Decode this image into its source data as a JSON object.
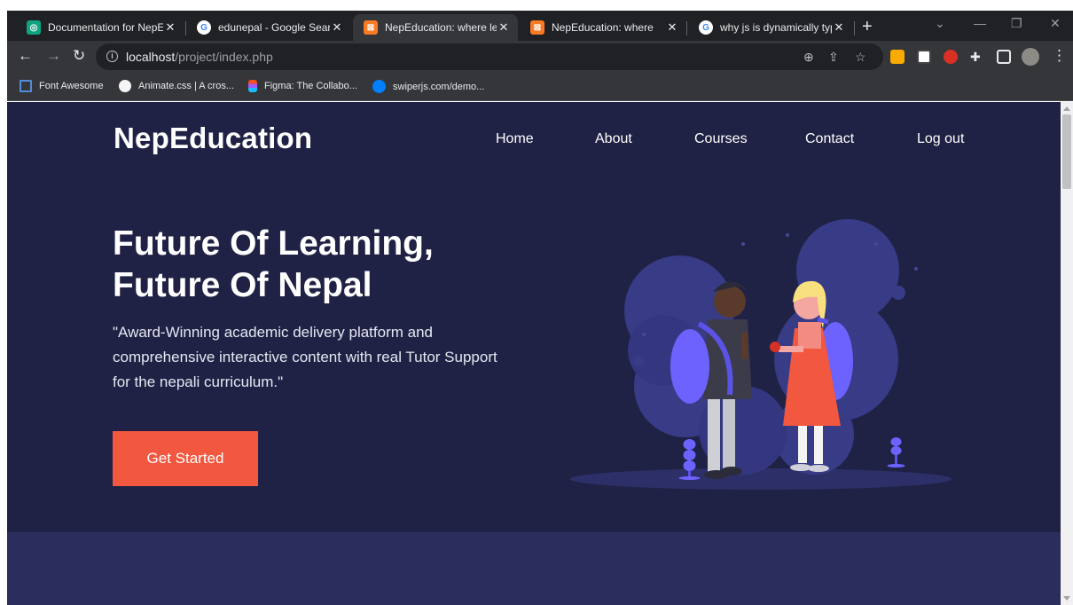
{
  "browser": {
    "tabs": [
      {
        "title": "Documentation for NepE",
        "favicon": "chatgpt-icon",
        "color": "#10a37f",
        "active": false
      },
      {
        "title": "edunepal - Google Search",
        "favicon": "google-icon",
        "color": "#ffffff",
        "active": false
      },
      {
        "title": "NepEducation: where lear",
        "favicon": "xampp-icon",
        "color": "#fb7a24",
        "active": true
      },
      {
        "title": "NepEducation: where",
        "favicon": "xampp-icon",
        "color": "#fb7a24",
        "active": false
      },
      {
        "title": "why js is dynamically type",
        "favicon": "google-icon",
        "color": "#ffffff",
        "active": false
      }
    ],
    "address": {
      "host": "localhost",
      "path": "/project/index.php"
    },
    "bookmarks": [
      {
        "label": "Font Awesome",
        "icon": "flag-icon",
        "color": "#538dd7"
      },
      {
        "label": "Animate.css | A cros...",
        "icon": "animate-icon",
        "color": "#1d1d1d"
      },
      {
        "label": "Figma: The Collabo...",
        "icon": "figma-icon",
        "color": "#f24e1e"
      },
      {
        "label": "swiperjs.com/demo...",
        "icon": "swiper-icon",
        "color": "#0080ff"
      }
    ]
  },
  "site": {
    "brand": "NepEducation",
    "nav": [
      "Home",
      "About",
      "Courses",
      "Contact",
      "Log out"
    ],
    "hero": {
      "title_line1": "Future Of Learning,",
      "title_line2": "Future Of Nepal",
      "description": "\"Award-Winning academic delivery platform and comprehensive interactive content with real Tutor Support for the nepali curriculum.\"",
      "cta": "Get Started"
    },
    "colors": {
      "background": "#1f2244",
      "section_below": "#2b2d5c",
      "accent": "#f2573f",
      "illustration_purple": "#6c63ff"
    }
  }
}
